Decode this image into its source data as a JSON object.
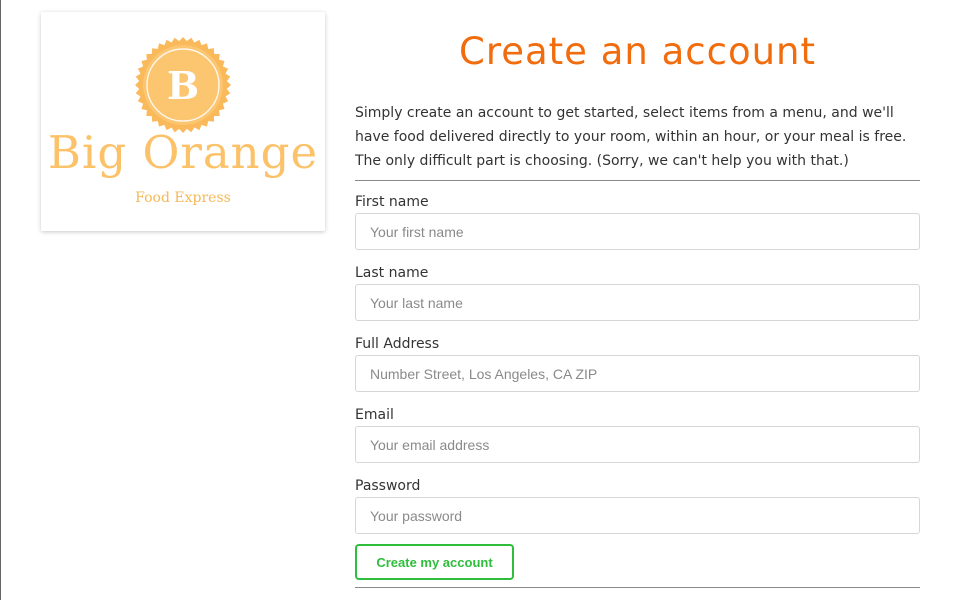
{
  "brand": {
    "initial": "B",
    "name": "Big Orange",
    "tagline": "Food Express"
  },
  "page": {
    "title": "Create an account",
    "intro": "Simply create an account to get started, select items from a menu, and we'll have food delivered directly to your room, within an hour, or your meal is free. The only difficult part is choosing. (Sorry, we can't help you with that.)"
  },
  "form": {
    "fields": [
      {
        "label": "First name",
        "placeholder": "Your first name",
        "value": ""
      },
      {
        "label": "Last name",
        "placeholder": "Your last name",
        "value": ""
      },
      {
        "label": "Full Address",
        "placeholder": "Number Street, Los Angeles, CA ZIP",
        "value": ""
      },
      {
        "label": "Email",
        "placeholder": "Your email address",
        "value": ""
      },
      {
        "label": "Password",
        "placeholder": "Your password",
        "value": ""
      }
    ],
    "submit_label": "Create my account"
  },
  "colors": {
    "title": "#f16c0d",
    "brand": "#fbc269",
    "seal": "#fab95a",
    "submit": "#2fbd3c"
  }
}
